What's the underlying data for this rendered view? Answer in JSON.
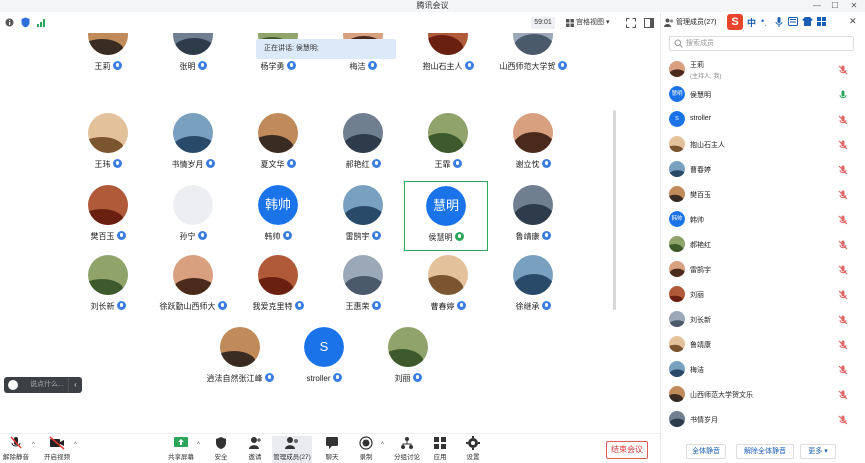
{
  "window": {
    "title": "腾讯会议"
  },
  "top": {
    "timer": "59:01",
    "view_label": "宫格视图",
    "manage_label": "管理成员(27)"
  },
  "speaking": "正在讲话: 侯慧明;",
  "gallery": {
    "rows": [
      [
        "王莉",
        "张明",
        "杨学勇",
        "梅洁",
        "抱山石主人",
        "山西师范大学贺"
      ],
      [
        "王玮",
        "书情岁月",
        "夏文华",
        "郝艳红",
        "王霏",
        "谢立忱"
      ],
      [
        "樊百玉",
        "孙宁",
        "韩帅",
        "雷鹄宇",
        "侯慧明",
        "鲁靖康"
      ],
      [
        "刘长新",
        "徐跃勤山西师大",
        "我爱克里特",
        "王惠荣",
        "曹春婷",
        "徐继承"
      ],
      [
        "逍法自然张江峰",
        "stroller",
        "刘丽"
      ]
    ],
    "text_avatars": {
      "韩帅": "韩帅",
      "侯慧明": "慧明",
      "stroller": "S"
    }
  },
  "chat": {
    "placeholder": "说点什么..."
  },
  "bottom": {
    "mute": "解除静音",
    "video": "开启视频",
    "share": "共享屏幕",
    "security": "安全",
    "invite": "邀请",
    "members": "管理成员(27)",
    "chat": "聊天",
    "record": "录制",
    "breakout": "分组讨论",
    "apps": "应用",
    "settings": "设置",
    "end": "结束会议"
  },
  "panel": {
    "search_placeholder": "搜索成员",
    "members": [
      {
        "name": "王莉",
        "sub": "(主持人, 我)"
      },
      {
        "name": "侯慧明",
        "avatar_text": "慧明"
      },
      {
        "name": "stroller",
        "avatar_text": "S"
      },
      {
        "name": "抱山石主人"
      },
      {
        "name": "曹春婷"
      },
      {
        "name": "樊百玉"
      },
      {
        "name": "韩帅",
        "avatar_text": "韩帅"
      },
      {
        "name": "郝艳红"
      },
      {
        "name": "雷鹄宇"
      },
      {
        "name": "刘丽"
      },
      {
        "name": "刘长新"
      },
      {
        "name": "鲁靖康"
      },
      {
        "name": "梅洁"
      },
      {
        "name": "山西师范大学贺文乐"
      },
      {
        "name": "书情岁月"
      }
    ],
    "mute_all": "全体静音",
    "unmute_all": "解除全体静音",
    "more": "更多"
  },
  "colors": {
    "accent": "#1a73e8",
    "speaking_green": "#2aa55a",
    "end_red": "#d93a3a",
    "muted_red": "#e06666"
  }
}
